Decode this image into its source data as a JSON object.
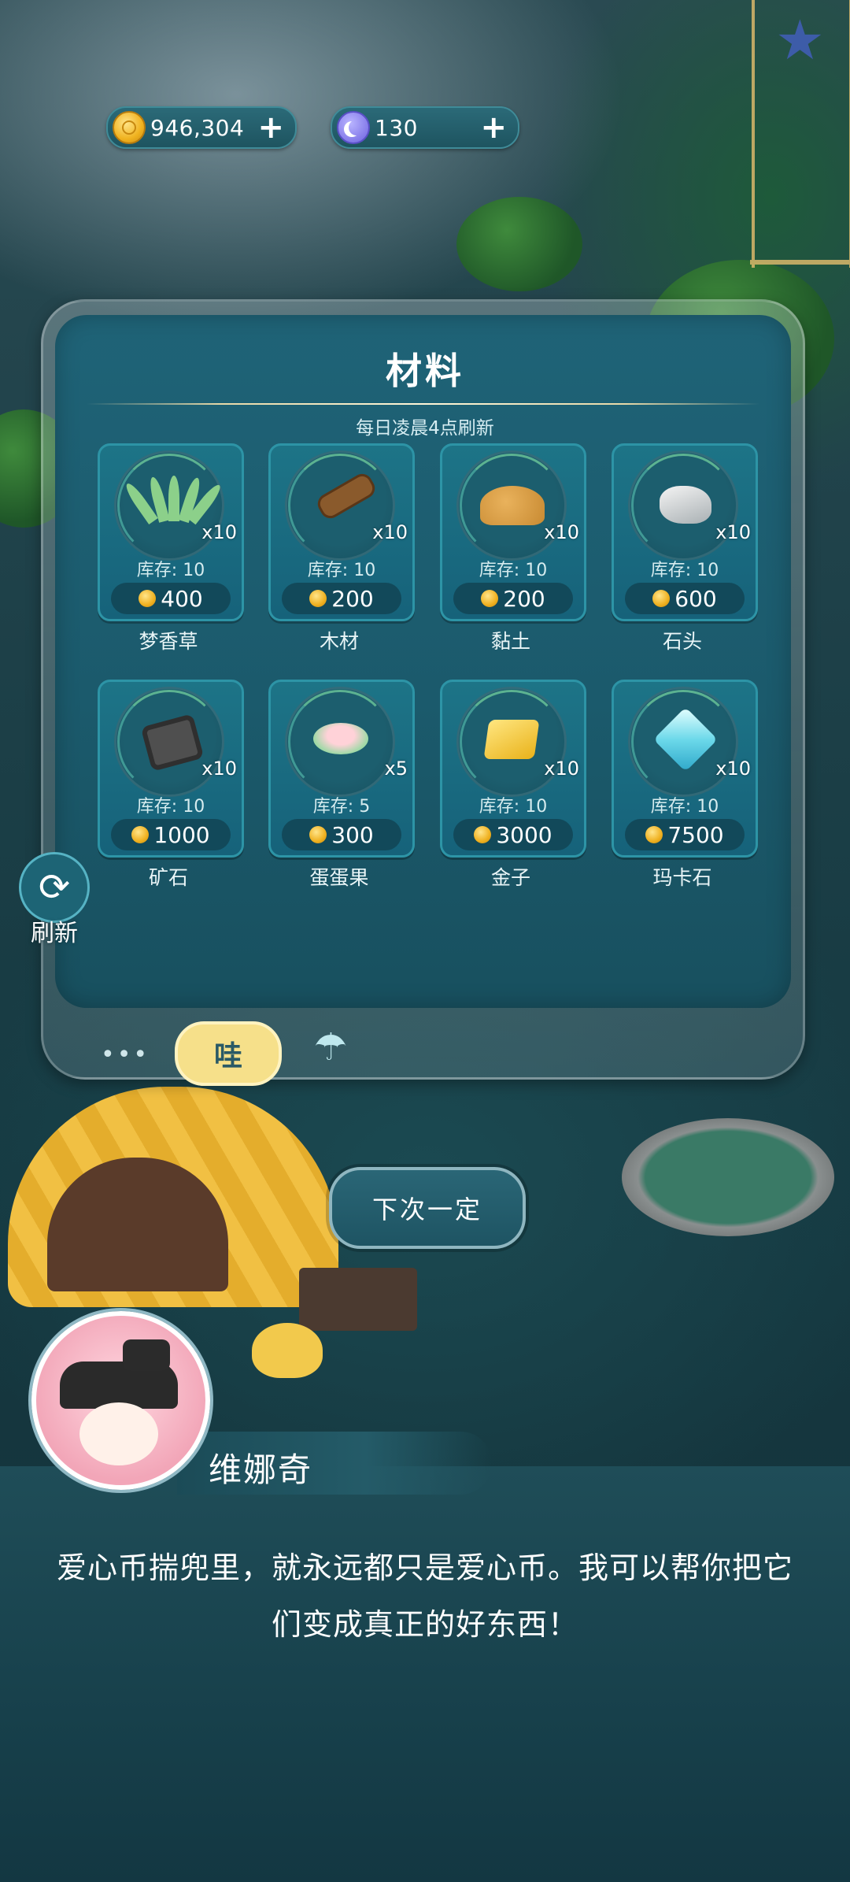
{
  "currency": {
    "coins": {
      "icon": "coin-icon",
      "value": "946,304",
      "add": "+"
    },
    "moons": {
      "icon": "moon-icon",
      "value": "130",
      "add": "+"
    }
  },
  "panel": {
    "title": "材料",
    "subtitle": "每日凌晨4点刷新",
    "items": [
      {
        "name": "梦香草",
        "icon": "grass-icon",
        "qty": "x10",
        "stock": "库存: 10",
        "price": "400"
      },
      {
        "name": "木材",
        "icon": "wood-log-icon",
        "qty": "x10",
        "stock": "库存: 10",
        "price": "200"
      },
      {
        "name": "黏土",
        "icon": "clay-icon",
        "qty": "x10",
        "stock": "库存: 10",
        "price": "200"
      },
      {
        "name": "石头",
        "icon": "stone-icon",
        "qty": "x10",
        "stock": "库存: 10",
        "price": "600"
      },
      {
        "name": "矿石",
        "icon": "ore-icon",
        "qty": "x10",
        "stock": "库存: 10",
        "price": "1000"
      },
      {
        "name": "蛋蛋果",
        "icon": "egg-fruit-icon",
        "qty": "x5",
        "stock": "库存: 5",
        "price": "300"
      },
      {
        "name": "金子",
        "icon": "gold-icon",
        "qty": "x10",
        "stock": "库存: 10",
        "price": "3000"
      },
      {
        "name": "玛卡石",
        "icon": "gem-icon",
        "qty": "x10",
        "stock": "库存: 10",
        "price": "7500"
      }
    ],
    "tabs": {
      "more": "•••",
      "shop": "哇",
      "umbrella": "☂"
    }
  },
  "refresh": {
    "label": "刷新",
    "icon": "refresh-icon"
  },
  "next_button": "下次一定",
  "dialog": {
    "speaker": "维娜奇",
    "text": "爱心币揣兜里，就永远都只是爱心币。我可以帮你把它们变成真正的好东西！"
  }
}
